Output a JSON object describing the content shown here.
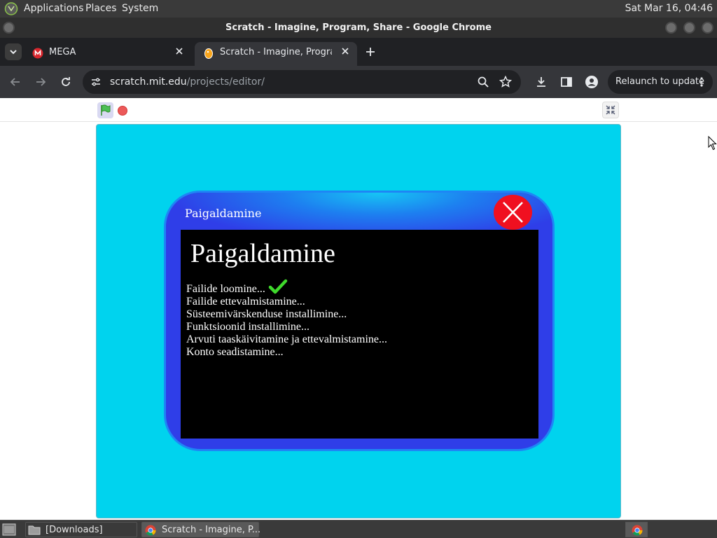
{
  "system_panel": {
    "menus": [
      "Applications",
      "Places",
      "System"
    ],
    "clock": "Sat Mar 16, 04:46"
  },
  "window": {
    "title": "Scratch - Imagine, Program, Share - Google Chrome"
  },
  "tabs": [
    {
      "label": "MEGA",
      "favicon": "mega-icon",
      "active": false
    },
    {
      "label": "Scratch - Imagine, Program, Share",
      "favicon": "scratch-icon",
      "active": true
    }
  ],
  "toolbar": {
    "url_host": "scratch.mit.edu",
    "url_path": "/projects/editor/",
    "relaunch_label": "Relaunch to update"
  },
  "dialog": {
    "title": "Paigaldamine",
    "heading": "Paigaldamine",
    "steps": [
      "Failide loomine...",
      "Failide ettevalmistamine...",
      "Süsteemivärskenduse installimine...",
      "Funktsioonid installimine...",
      "Arvuti taaskäivitamine ja ettevalmistamine...",
      "Konto seadistamine..."
    ]
  },
  "taskbar": {
    "items": [
      {
        "label": "[Downloads]",
        "icon": "folder-icon"
      },
      {
        "label": "Scratch - Imagine, P...",
        "icon": "chrome-icon"
      }
    ]
  },
  "colors": {
    "stage_bg": "#00d3ee",
    "dialog_frame": "#2f3ee8",
    "close_button": "#f01020",
    "check": "#3fd92c"
  }
}
